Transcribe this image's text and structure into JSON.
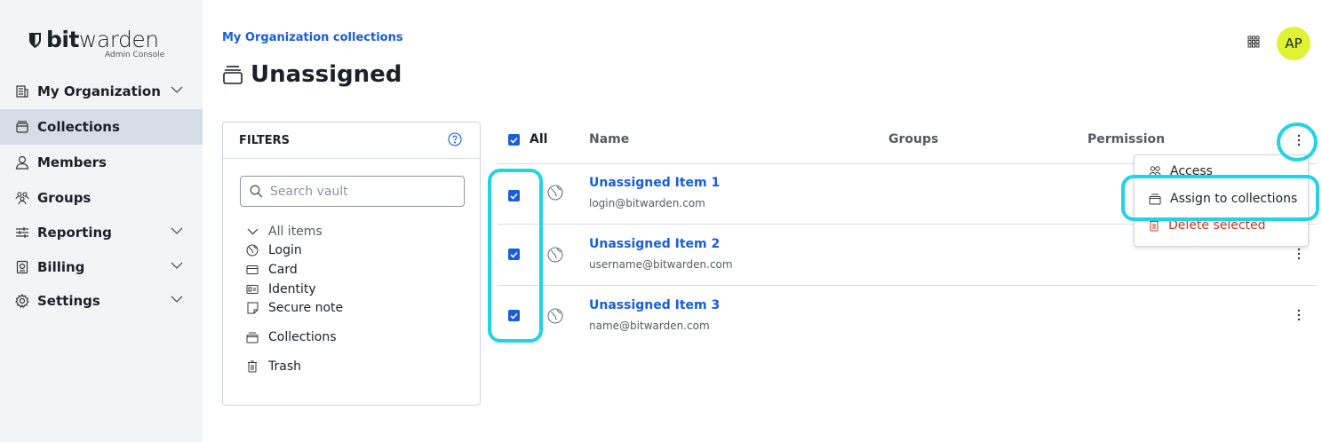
{
  "brand": {
    "name_bold": "bit",
    "name_light": "warden",
    "subtitle": "Admin Console"
  },
  "sidebar": {
    "items": [
      {
        "label": "My Organization",
        "icon": "organization-icon",
        "expandable": true
      },
      {
        "label": "Collections",
        "icon": "collection-icon",
        "active": true
      },
      {
        "label": "Members",
        "icon": "user-icon"
      },
      {
        "label": "Groups",
        "icon": "groups-icon"
      },
      {
        "label": "Reporting",
        "icon": "sliders-icon",
        "expandable": true
      },
      {
        "label": "Billing",
        "icon": "billing-icon",
        "expandable": true
      },
      {
        "label": "Settings",
        "icon": "gear-icon",
        "expandable": true
      }
    ]
  },
  "header": {
    "breadcrumb": "My Organization collections",
    "title": "Unassigned",
    "avatar_initials": "AP"
  },
  "filters": {
    "heading": "FILTERS",
    "search_placeholder": "Search vault",
    "items": [
      {
        "label": "All items",
        "icon": "chevron-down-icon"
      },
      {
        "label": "Login",
        "icon": "globe-icon"
      },
      {
        "label": "Card",
        "icon": "card-icon"
      },
      {
        "label": "Identity",
        "icon": "id-card-icon"
      },
      {
        "label": "Secure note",
        "icon": "note-icon"
      },
      {
        "label": "Collections",
        "icon": "collection-icon"
      },
      {
        "label": "Trash",
        "icon": "trash-icon"
      }
    ]
  },
  "table": {
    "columns": {
      "all": "All",
      "name": "Name",
      "groups": "Groups",
      "permission": "Permission"
    },
    "rows": [
      {
        "name": "Unassigned Item 1",
        "subtitle": "login@bitwarden.com",
        "checked": true
      },
      {
        "name": "Unassigned Item 2",
        "subtitle": "username@bitwarden.com",
        "checked": true
      },
      {
        "name": "Unassigned Item 3",
        "subtitle": "name@bitwarden.com",
        "checked": true
      }
    ]
  },
  "bulk_menu": {
    "items": [
      {
        "label": "Access",
        "icon": "users-icon"
      },
      {
        "label": "Assign to collections",
        "icon": "collection-icon"
      },
      {
        "label": "Delete selected",
        "icon": "trash-icon",
        "danger": true
      }
    ]
  },
  "colors": {
    "accent": "#175ddc",
    "highlight": "#22d3e4",
    "avatar": "#dff234",
    "danger": "#c83522",
    "sidebar_active": "#d6dce6"
  }
}
